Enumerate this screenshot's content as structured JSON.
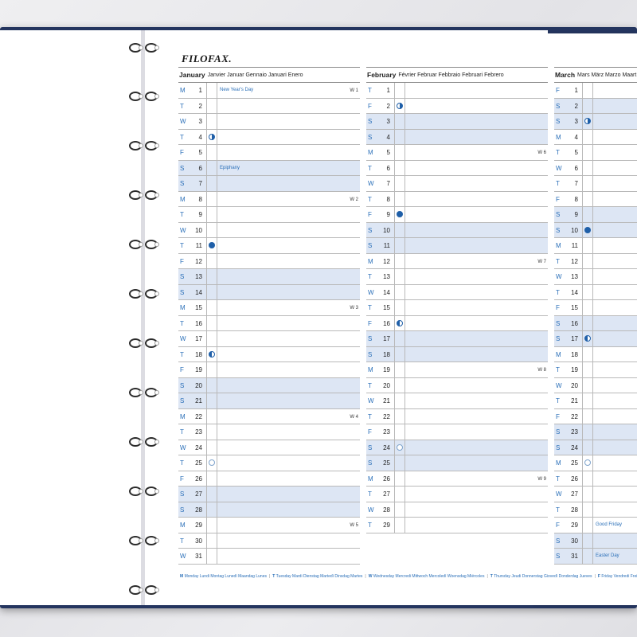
{
  "brand": "FILOFAX.",
  "months": [
    {
      "id": "jan",
      "name": "January",
      "translations": "Janvier  Januar  Gennaio  Januari  Enero",
      "days": [
        {
          "wd": "M",
          "d": "1",
          "event": "New Year's Day",
          "week": "W 1"
        },
        {
          "wd": "T",
          "d": "2"
        },
        {
          "wd": "W",
          "d": "3"
        },
        {
          "wd": "T",
          "d": "4",
          "moon": "first"
        },
        {
          "wd": "F",
          "d": "5"
        },
        {
          "wd": "S",
          "d": "6",
          "we": true,
          "event": "Epiphany"
        },
        {
          "wd": "S",
          "d": "7",
          "we": true
        },
        {
          "wd": "M",
          "d": "8",
          "week": "W 2"
        },
        {
          "wd": "T",
          "d": "9"
        },
        {
          "wd": "W",
          "d": "10"
        },
        {
          "wd": "T",
          "d": "11",
          "moon": "full"
        },
        {
          "wd": "F",
          "d": "12"
        },
        {
          "wd": "S",
          "d": "13",
          "we": true
        },
        {
          "wd": "S",
          "d": "14",
          "we": true
        },
        {
          "wd": "M",
          "d": "15",
          "week": "W 3"
        },
        {
          "wd": "T",
          "d": "16"
        },
        {
          "wd": "W",
          "d": "17"
        },
        {
          "wd": "T",
          "d": "18",
          "moon": "last"
        },
        {
          "wd": "F",
          "d": "19"
        },
        {
          "wd": "S",
          "d": "20",
          "we": true
        },
        {
          "wd": "S",
          "d": "21",
          "we": true
        },
        {
          "wd": "M",
          "d": "22",
          "week": "W 4"
        },
        {
          "wd": "T",
          "d": "23"
        },
        {
          "wd": "W",
          "d": "24"
        },
        {
          "wd": "T",
          "d": "25",
          "moon": "new"
        },
        {
          "wd": "F",
          "d": "26"
        },
        {
          "wd": "S",
          "d": "27",
          "we": true
        },
        {
          "wd": "S",
          "d": "28",
          "we": true
        },
        {
          "wd": "M",
          "d": "29",
          "week": "W 5"
        },
        {
          "wd": "T",
          "d": "30"
        },
        {
          "wd": "W",
          "d": "31"
        }
      ]
    },
    {
      "id": "feb",
      "name": "February",
      "translations": "Février  Februar  Febbraio  Februari  Febrero",
      "days": [
        {
          "wd": "T",
          "d": "1"
        },
        {
          "wd": "F",
          "d": "2",
          "moon": "first"
        },
        {
          "wd": "S",
          "d": "3",
          "we": true
        },
        {
          "wd": "S",
          "d": "4",
          "we": true
        },
        {
          "wd": "M",
          "d": "5",
          "week": "W 6"
        },
        {
          "wd": "T",
          "d": "6"
        },
        {
          "wd": "W",
          "d": "7"
        },
        {
          "wd": "T",
          "d": "8"
        },
        {
          "wd": "F",
          "d": "9",
          "moon": "full"
        },
        {
          "wd": "S",
          "d": "10",
          "we": true
        },
        {
          "wd": "S",
          "d": "11",
          "we": true
        },
        {
          "wd": "M",
          "d": "12",
          "week": "W 7"
        },
        {
          "wd": "T",
          "d": "13"
        },
        {
          "wd": "W",
          "d": "14"
        },
        {
          "wd": "T",
          "d": "15"
        },
        {
          "wd": "F",
          "d": "16",
          "moon": "last"
        },
        {
          "wd": "S",
          "d": "17",
          "we": true
        },
        {
          "wd": "S",
          "d": "18",
          "we": true
        },
        {
          "wd": "M",
          "d": "19",
          "week": "W 8"
        },
        {
          "wd": "T",
          "d": "20"
        },
        {
          "wd": "W",
          "d": "21"
        },
        {
          "wd": "T",
          "d": "22"
        },
        {
          "wd": "F",
          "d": "23"
        },
        {
          "wd": "S",
          "d": "24",
          "we": true,
          "moon": "new"
        },
        {
          "wd": "S",
          "d": "25",
          "we": true
        },
        {
          "wd": "M",
          "d": "26",
          "week": "W 9"
        },
        {
          "wd": "T",
          "d": "27"
        },
        {
          "wd": "W",
          "d": "28"
        },
        {
          "wd": "T",
          "d": "29"
        }
      ]
    },
    {
      "id": "mar",
      "name": "March",
      "translations": "Mars  März  Marzo  Maart",
      "days": [
        {
          "wd": "F",
          "d": "1"
        },
        {
          "wd": "S",
          "d": "2",
          "we": true
        },
        {
          "wd": "S",
          "d": "3",
          "we": true,
          "moon": "first"
        },
        {
          "wd": "M",
          "d": "4"
        },
        {
          "wd": "T",
          "d": "5"
        },
        {
          "wd": "W",
          "d": "6"
        },
        {
          "wd": "T",
          "d": "7"
        },
        {
          "wd": "F",
          "d": "8"
        },
        {
          "wd": "S",
          "d": "9",
          "we": true
        },
        {
          "wd": "S",
          "d": "10",
          "we": true,
          "moon": "full"
        },
        {
          "wd": "M",
          "d": "11"
        },
        {
          "wd": "T",
          "d": "12"
        },
        {
          "wd": "W",
          "d": "13"
        },
        {
          "wd": "T",
          "d": "14"
        },
        {
          "wd": "F",
          "d": "15"
        },
        {
          "wd": "S",
          "d": "16",
          "we": true
        },
        {
          "wd": "S",
          "d": "17",
          "we": true,
          "moon": "last"
        },
        {
          "wd": "M",
          "d": "18"
        },
        {
          "wd": "T",
          "d": "19"
        },
        {
          "wd": "W",
          "d": "20"
        },
        {
          "wd": "T",
          "d": "21"
        },
        {
          "wd": "F",
          "d": "22"
        },
        {
          "wd": "S",
          "d": "23",
          "we": true
        },
        {
          "wd": "S",
          "d": "24",
          "we": true
        },
        {
          "wd": "M",
          "d": "25",
          "moon": "new"
        },
        {
          "wd": "T",
          "d": "26"
        },
        {
          "wd": "W",
          "d": "27"
        },
        {
          "wd": "T",
          "d": "28"
        },
        {
          "wd": "F",
          "d": "29",
          "event": "Good Friday"
        },
        {
          "wd": "S",
          "d": "30",
          "we": true
        },
        {
          "wd": "S",
          "d": "31",
          "we": true,
          "event": "Easter Day"
        }
      ]
    }
  ],
  "footer": [
    {
      "abbr": "M",
      "words": "Monday  Lundi  Montag  Lunedì  Maandag  Lunes"
    },
    {
      "abbr": "T",
      "words": "Tuesday  Mardi  Dienstag  Martedì  Dinsdag  Martes"
    },
    {
      "abbr": "W",
      "words": "Wednesday  Mercredi  Mittwoch  Mercoledì  Woensdag  Miércoles"
    },
    {
      "abbr": "T",
      "words": "Thursday  Jeudi  Donnerstag  Giovedì  Donderdag  Jueves"
    },
    {
      "abbr": "F",
      "words": "Friday  Vendredi  Freitag"
    }
  ],
  "colors": {
    "accent": "#2a6fb8",
    "weekend_fill": "#dde6f4",
    "cover": "#24355f"
  }
}
